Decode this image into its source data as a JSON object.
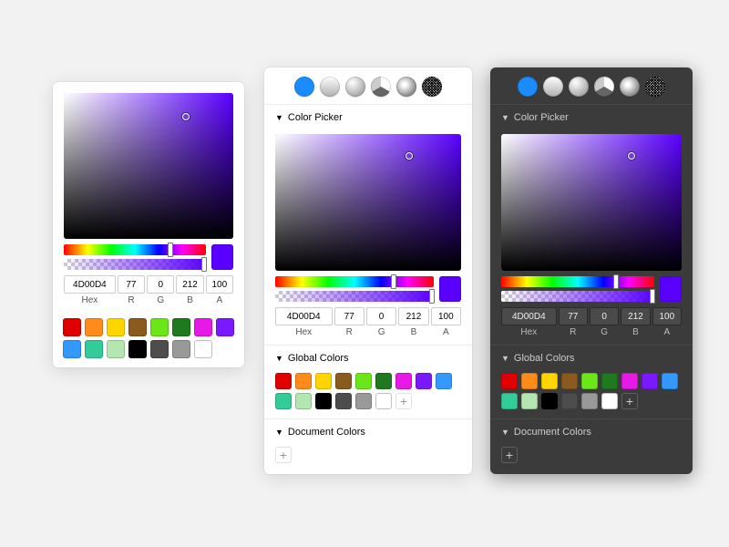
{
  "sections": {
    "picker_label": "Color Picker",
    "global_label": "Global Colors",
    "document_label": "Document Colors"
  },
  "fill_types": [
    {
      "id": "solid",
      "name": "Solid Color",
      "active": true
    },
    {
      "id": "linear",
      "name": "Linear Gradient",
      "active": false
    },
    {
      "id": "radial",
      "name": "Radial Gradient",
      "active": false
    },
    {
      "id": "angular",
      "name": "Angular Gradient",
      "active": false
    },
    {
      "id": "image",
      "name": "Image Fill",
      "active": false
    },
    {
      "id": "noise",
      "name": "Noise Fill",
      "active": false
    }
  ],
  "color": {
    "hex": "4D00D4",
    "r": "77",
    "g": "0",
    "b": "212",
    "a": "100"
  },
  "labels": {
    "hex": "Hex",
    "r": "R",
    "g": "G",
    "b": "B",
    "a": "A"
  },
  "swatches": [
    "#e00000",
    "#ff8c1a",
    "#ffd500",
    "#8a5a1f",
    "#6be619",
    "#1f7a1f",
    "#e619e6",
    "#7a19ff",
    "#3399ff",
    "#33cc99",
    "#b3e6b0",
    "#000000",
    "#4d4d4d",
    "#999999",
    "#ffffff"
  ],
  "add_label": "+"
}
